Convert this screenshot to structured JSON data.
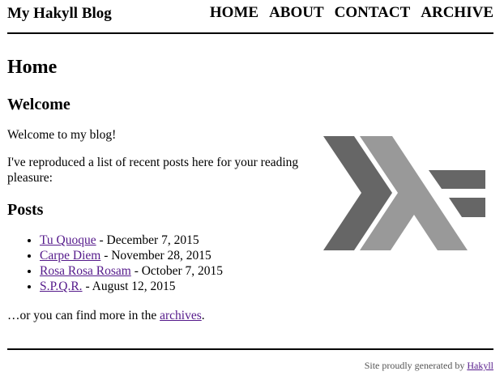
{
  "header": {
    "logo": "My Hakyll Blog",
    "nav": [
      "HOME",
      "ABOUT",
      "CONTACT",
      "ARCHIVE"
    ]
  },
  "main": {
    "title": "Home",
    "welcome_heading": "Welcome",
    "welcome_text": "Welcome to my blog!",
    "intro_text": "I've reproduced a list of recent posts here for your reading pleasure:",
    "posts_heading": "Posts",
    "posts": [
      {
        "title": "Tu Quoque",
        "date": " - December 7, 2015"
      },
      {
        "title": "Carpe Diem",
        "date": " - November 28, 2015"
      },
      {
        "title": "Rosa Rosa Rosam",
        "date": " - October 7, 2015"
      },
      {
        "title": "S.P.Q.R.",
        "date": " - August 12, 2015"
      }
    ],
    "archive_prefix": "…or you can find more in the ",
    "archive_link": "archives",
    "archive_suffix": "."
  },
  "footer": {
    "prefix": "Site proudly generated by ",
    "link": "Hakyll"
  },
  "colors": {
    "link": "#551a8b",
    "logo_dark": "#666666",
    "logo_light": "#999999"
  },
  "icons": {
    "haskell_logo": "haskell-logo-icon"
  }
}
